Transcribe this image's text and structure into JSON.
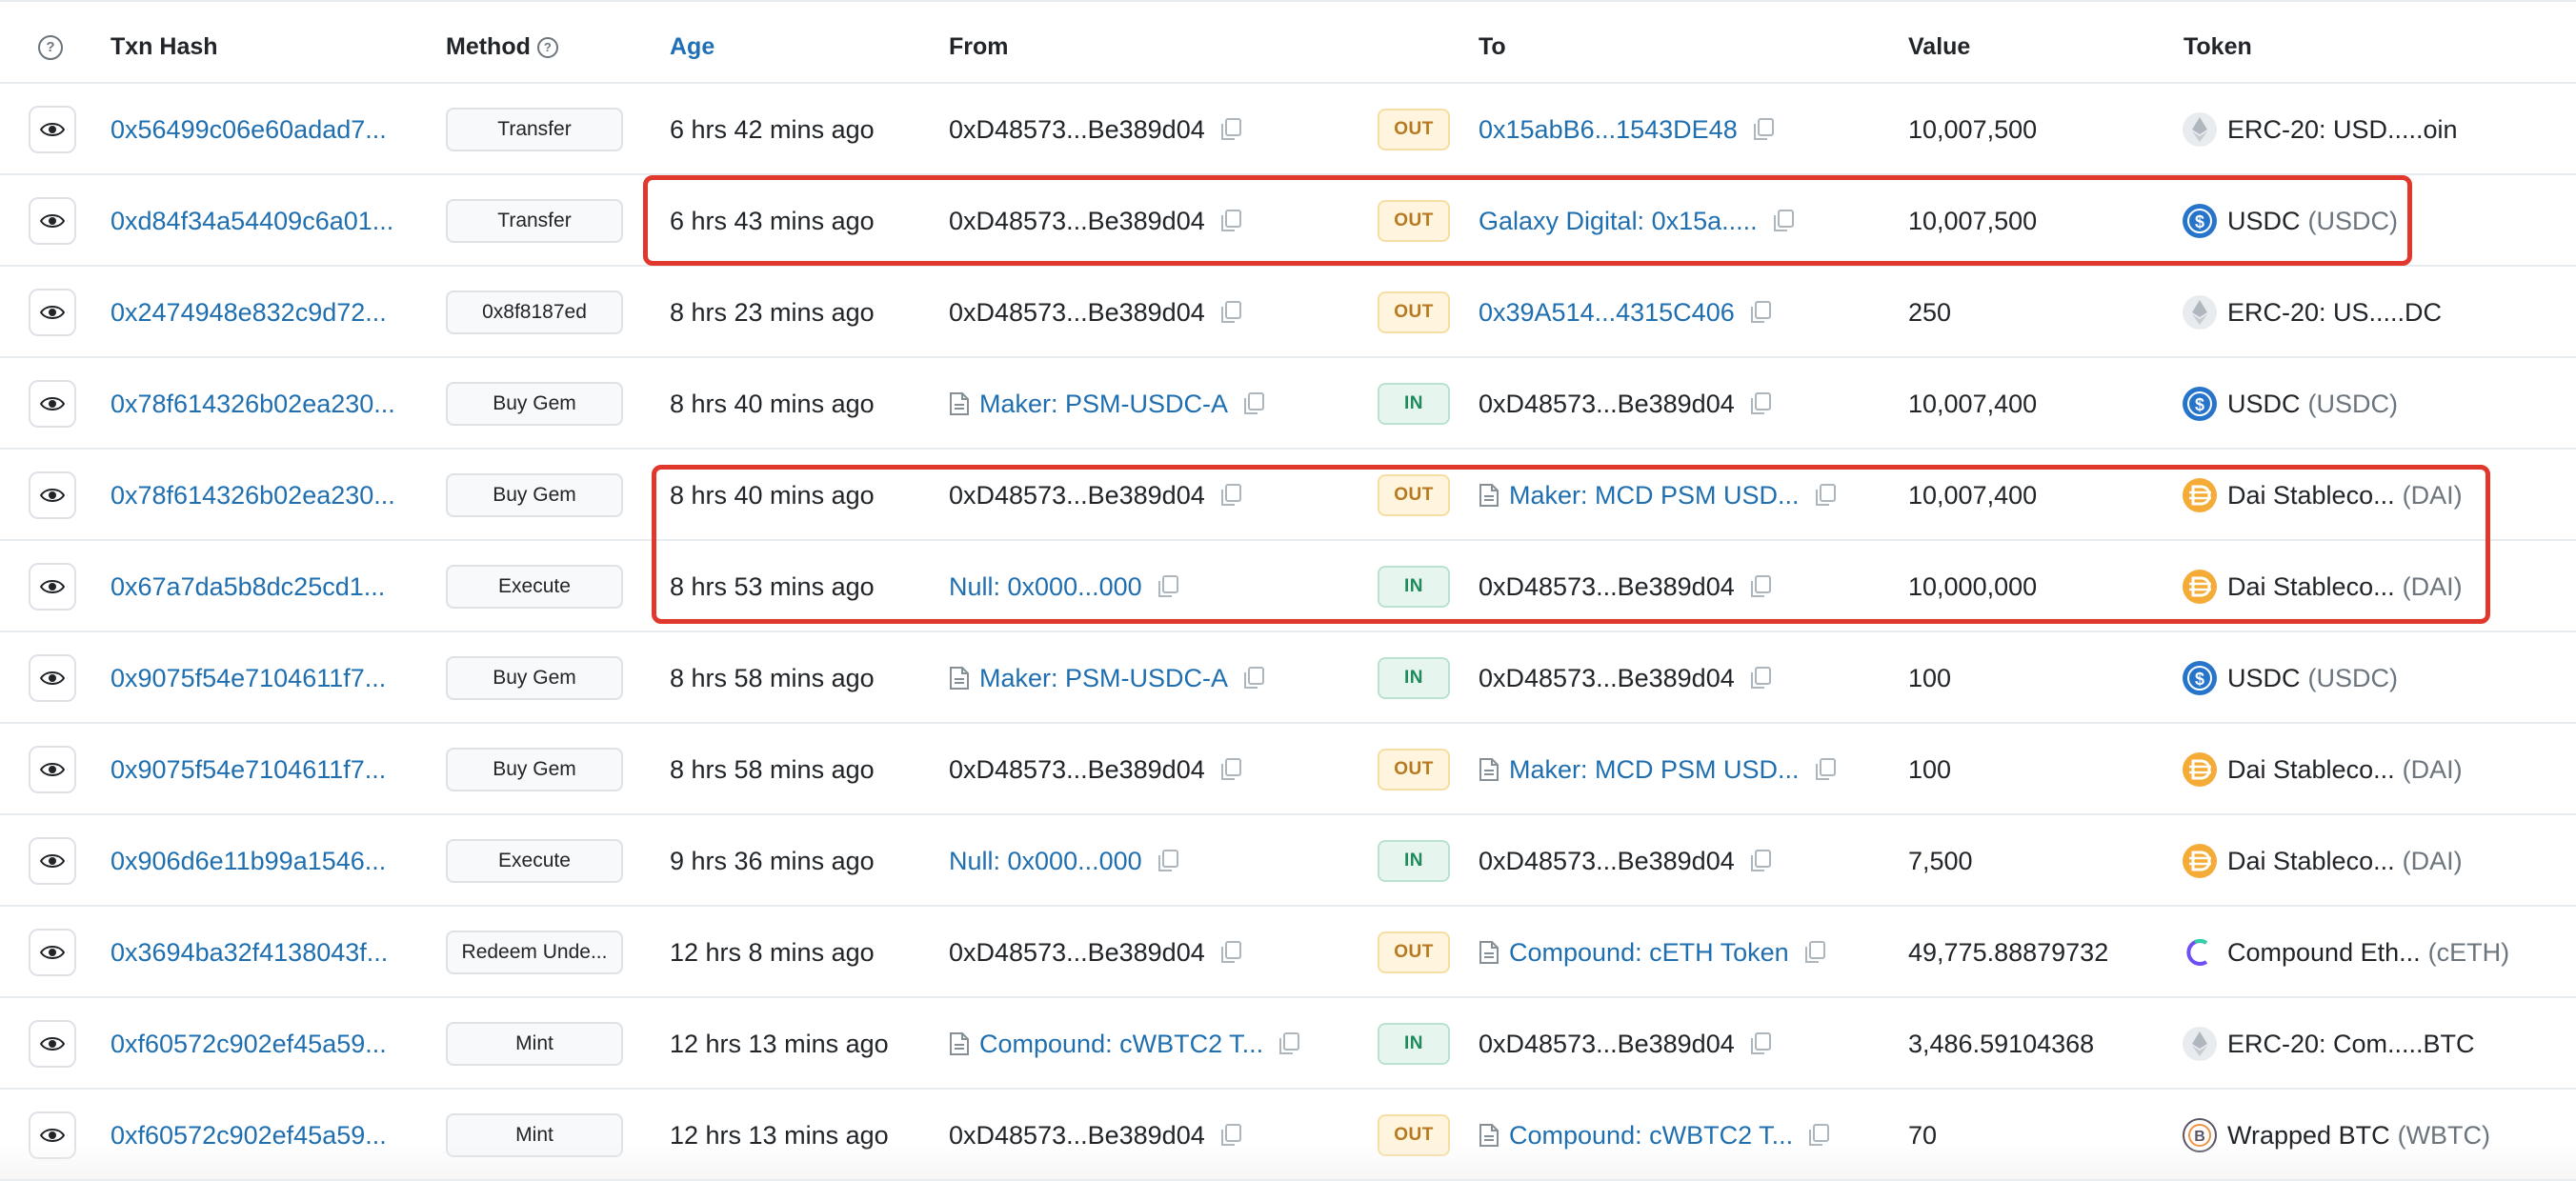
{
  "headers": {
    "help": "?",
    "txn_hash": "Txn Hash",
    "method": "Method",
    "age": "Age",
    "from": "From",
    "to": "To",
    "value": "Value",
    "token": "Token"
  },
  "colors": {
    "link": "#1f6fb0",
    "out_badge": "#b7791f",
    "in_badge": "#1f8a5b",
    "highlight": "#e0382c"
  },
  "rows": [
    {
      "hash": "0x56499c06e60adad7...",
      "method": "Transfer",
      "age": "6 hrs 42 mins ago",
      "from": "0xD48573...Be389d04",
      "dir": "OUT",
      "to": "0x15abB6...1543DE48",
      "value": "10,007,500",
      "token_name": "ERC-20: USD.....oin",
      "token_symbol": "",
      "token_icon": "eth-icon"
    },
    {
      "hash": "0xd84f34a54409c6a01...",
      "method": "Transfer",
      "age": "6 hrs 43 mins ago",
      "from": "0xD48573...Be389d04",
      "dir": "OUT",
      "to": "Galaxy Digital: 0x15a.....",
      "value": "10,007,500",
      "token_name": "USDC",
      "token_symbol": "(USDC)",
      "token_icon": "usdc-icon"
    },
    {
      "hash": "0x2474948e832c9d72...",
      "method": "0x8f8187ed",
      "age": "8 hrs 23 mins ago",
      "from": "0xD48573...Be389d04",
      "dir": "OUT",
      "to": "0x39A514...4315C406",
      "value": "250",
      "token_name": "ERC-20: US.....DC",
      "token_symbol": "",
      "token_icon": "eth-icon"
    },
    {
      "hash": "0x78f614326b02ea230...",
      "method": "Buy Gem",
      "age": "8 hrs 40 mins ago",
      "from": "Maker: PSM-USDC-A",
      "dir": "IN",
      "to": "0xD48573...Be389d04",
      "value": "10,007,400",
      "token_name": "USDC",
      "token_symbol": "(USDC)",
      "token_icon": "usdc-icon"
    },
    {
      "hash": "0x78f614326b02ea230...",
      "method": "Buy Gem",
      "age": "8 hrs 40 mins ago",
      "from": "0xD48573...Be389d04",
      "dir": "OUT",
      "to": "Maker: MCD PSM USD...",
      "value": "10,007,400",
      "token_name": "Dai Stableco...",
      "token_symbol": "(DAI)",
      "token_icon": "dai-icon"
    },
    {
      "hash": "0x67a7da5b8dc25cd1...",
      "method": "Execute",
      "age": "8 hrs 53 mins ago",
      "from": "Null: 0x000...000",
      "dir": "IN",
      "to": "0xD48573...Be389d04",
      "value": "10,000,000",
      "token_name": "Dai Stableco...",
      "token_symbol": "(DAI)",
      "token_icon": "dai-icon"
    },
    {
      "hash": "0x9075f54e7104611f7...",
      "method": "Buy Gem",
      "age": "8 hrs 58 mins ago",
      "from": "Maker: PSM-USDC-A",
      "dir": "IN",
      "to": "0xD48573...Be389d04",
      "value": "100",
      "token_name": "USDC",
      "token_symbol": "(USDC)",
      "token_icon": "usdc-icon"
    },
    {
      "hash": "0x9075f54e7104611f7...",
      "method": "Buy Gem",
      "age": "8 hrs 58 mins ago",
      "from": "0xD48573...Be389d04",
      "dir": "OUT",
      "to": "Maker: MCD PSM USD...",
      "value": "100",
      "token_name": "Dai Stableco...",
      "token_symbol": "(DAI)",
      "token_icon": "dai-icon"
    },
    {
      "hash": "0x906d6e11b99a1546...",
      "method": "Execute",
      "age": "9 hrs 36 mins ago",
      "from": "Null: 0x000...000",
      "dir": "IN",
      "to": "0xD48573...Be389d04",
      "value": "7,500",
      "token_name": "Dai Stableco...",
      "token_symbol": "(DAI)",
      "token_icon": "dai-icon"
    },
    {
      "hash": "0x3694ba32f4138043f...",
      "method": "Redeem Unde...",
      "age": "12 hrs 8 mins ago",
      "from": "0xD48573...Be389d04",
      "dir": "OUT",
      "to": "Compound: cETH Token",
      "value": "49,775.88879732",
      "token_name": "Compound Eth...",
      "token_symbol": "(cETH)",
      "token_icon": "compound-icon"
    },
    {
      "hash": "0xf60572c902ef45a59...",
      "method": "Mint",
      "age": "12 hrs 13 mins ago",
      "from": "Compound: cWBTC2 T...",
      "dir": "IN",
      "to": "0xD48573...Be389d04",
      "value": "3,486.59104368",
      "token_name": "ERC-20: Com.....BTC",
      "token_symbol": "",
      "token_icon": "eth-icon"
    },
    {
      "hash": "0xf60572c902ef45a59...",
      "method": "Mint",
      "age": "12 hrs 13 mins ago",
      "from": "0xD48573...Be389d04",
      "dir": "OUT",
      "to": "Compound: cWBTC2 T...",
      "value": "70",
      "token_name": "Wrapped BTC",
      "token_symbol": "(WBTC)",
      "token_icon": "wbtc-icon"
    }
  ]
}
